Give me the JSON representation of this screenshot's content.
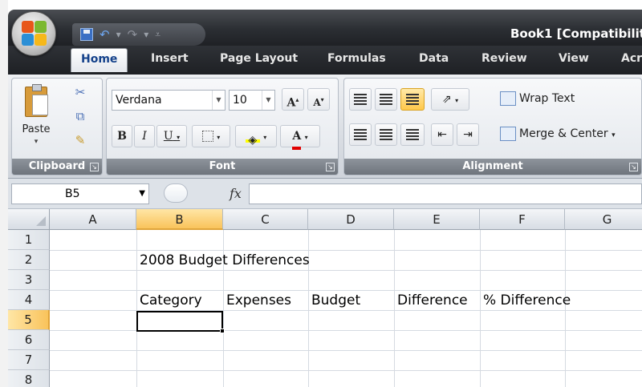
{
  "window": {
    "title": "Book1  [Compatibilit"
  },
  "quick_access": {
    "save_icon": "save-icon",
    "undo_icon": "undo-icon",
    "redo_icon": "redo-icon",
    "customize_icon": "customize-qat-icon"
  },
  "tabs": [
    {
      "label": "Home",
      "active": true
    },
    {
      "label": "Insert"
    },
    {
      "label": "Page Layout"
    },
    {
      "label": "Formulas"
    },
    {
      "label": "Data"
    },
    {
      "label": "Review"
    },
    {
      "label": "View"
    },
    {
      "label": "Acr"
    }
  ],
  "ribbon": {
    "clipboard": {
      "group_label": "Clipboard",
      "paste_label": "Paste"
    },
    "font": {
      "group_label": "Font",
      "font_name": "Verdana",
      "font_size": "10",
      "bold": "B",
      "italic": "I",
      "underline": "U",
      "grow": "A",
      "shrink": "A",
      "color_letter": "A"
    },
    "alignment": {
      "group_label": "Alignment",
      "wrap_text": "Wrap Text",
      "merge_center": "Merge & Center"
    }
  },
  "formula_bar": {
    "name_box": "B5",
    "fx": "fx",
    "value": ""
  },
  "sheet": {
    "columns": [
      "A",
      "B",
      "C",
      "D",
      "E",
      "F",
      "G"
    ],
    "rows": [
      "1",
      "2",
      "3",
      "4",
      "5",
      "6",
      "7",
      "8"
    ],
    "selected_column": "B",
    "selected_row": "5",
    "cells": {
      "B2": "2008 Budget Differences",
      "B4": "Category",
      "C4": "Expenses",
      "D4": "Budget",
      "E4": "Difference",
      "F4": "% Difference"
    }
  },
  "colors": {
    "selection_header": "#f9c35b",
    "title_bar": "#2b2e33",
    "ribbon_bg": "#dfe3e8",
    "accent_blue": "#15428b"
  }
}
